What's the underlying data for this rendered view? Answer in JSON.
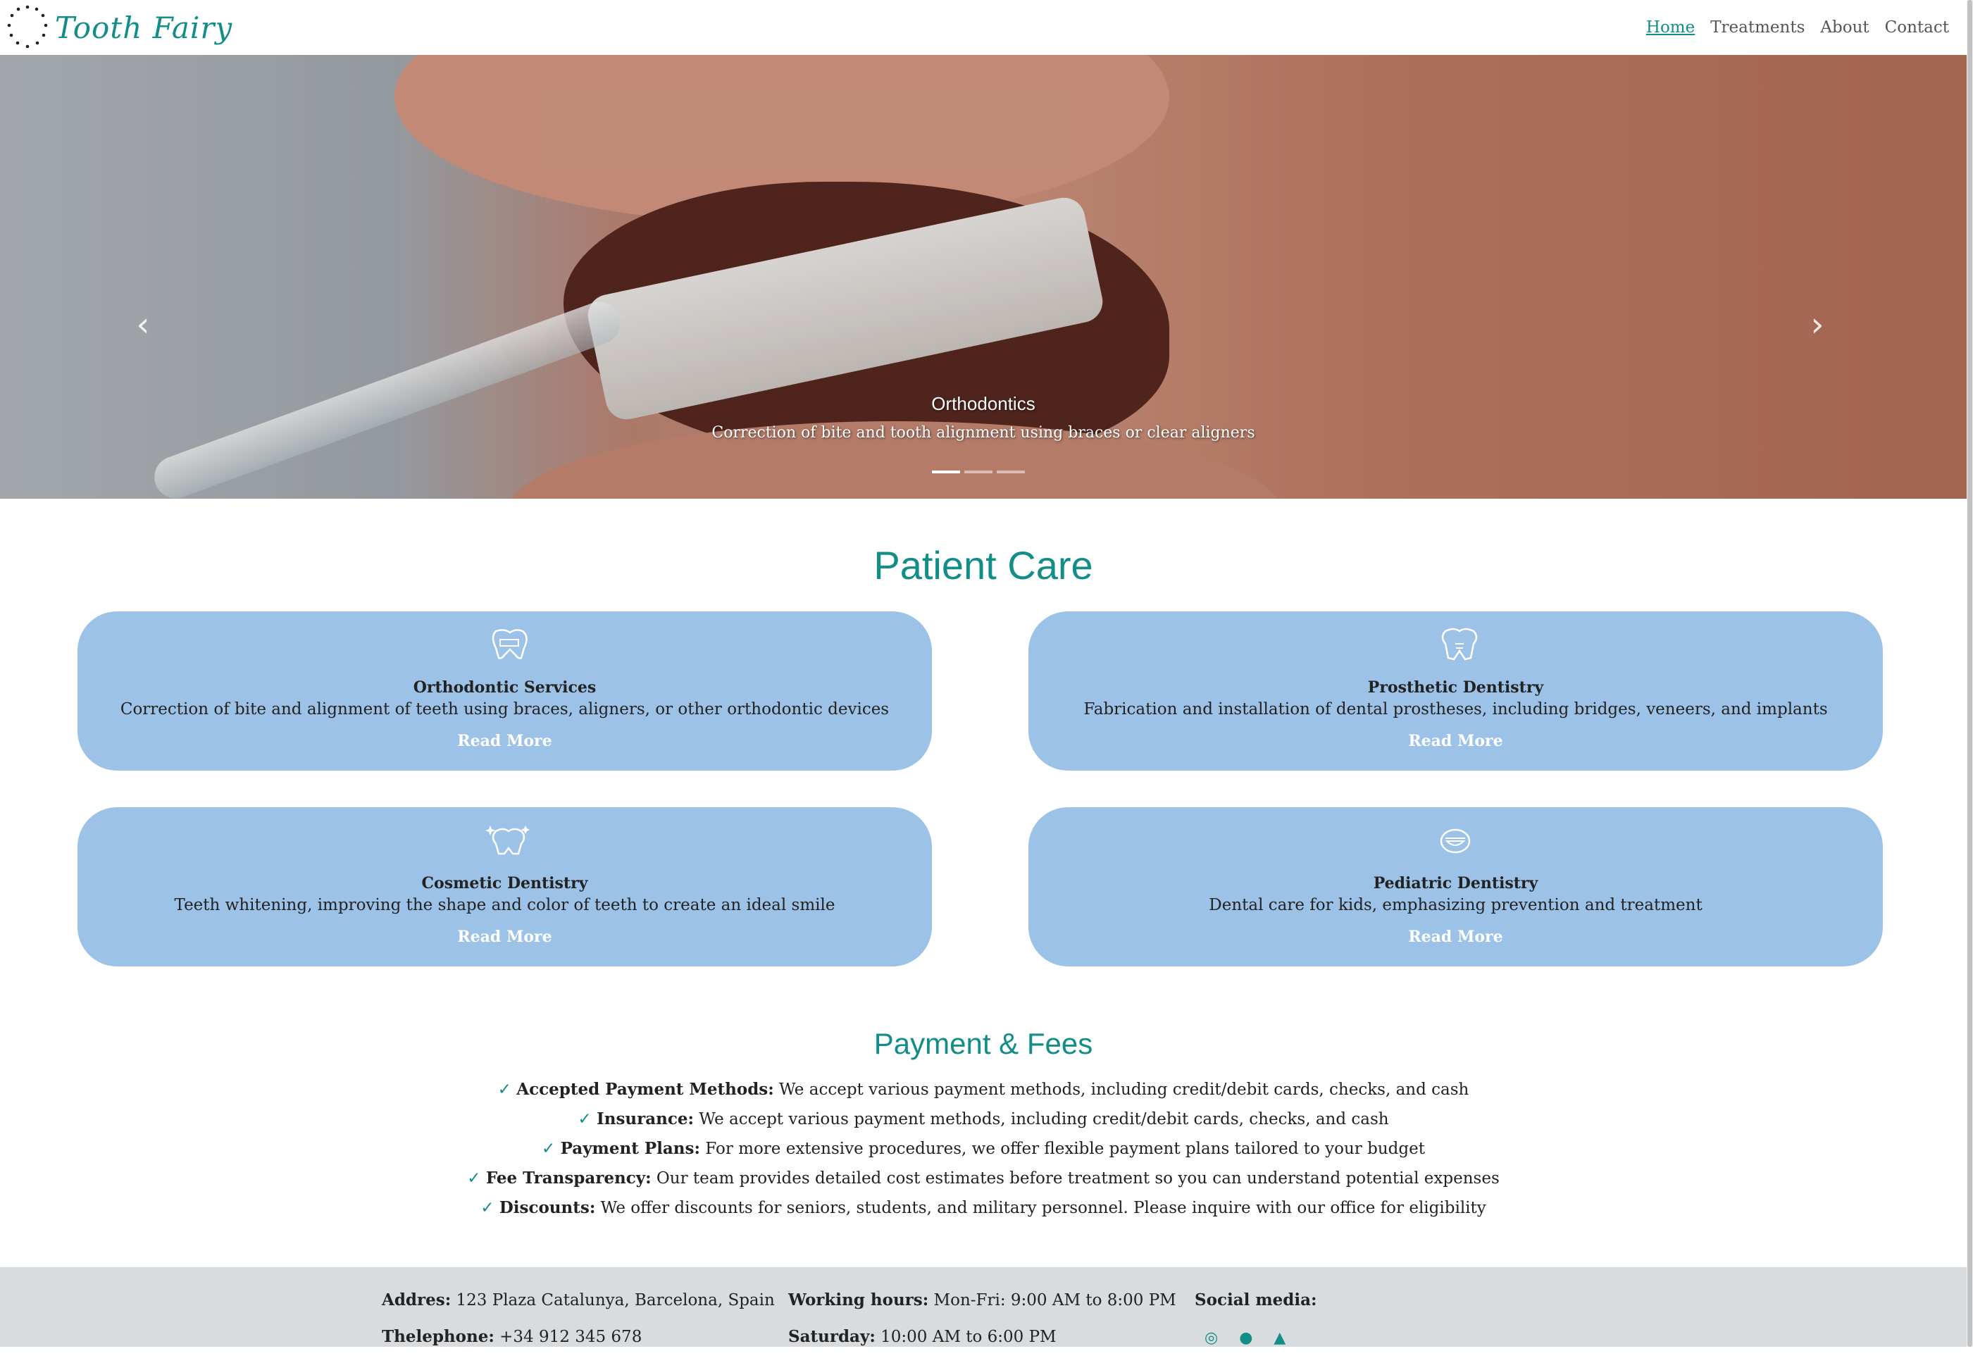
{
  "brand": {
    "name": "Tooth Fairy"
  },
  "nav": [
    {
      "label": "Home",
      "active": true
    },
    {
      "label": "Treatments"
    },
    {
      "label": "About"
    },
    {
      "label": "Contact"
    }
  ],
  "hero": {
    "title": "Orthodontics",
    "subtitle": "Correction of bite and tooth alignment using braces or clear aligners",
    "active_slide": 1,
    "slide_count": 3
  },
  "patient_care": {
    "title": "Patient Care",
    "cards": [
      {
        "icon": "braces-tooth-icon",
        "title": "Orthodontic Services",
        "desc": "Correction of bite and alignment of teeth using braces, aligners, or other orthodontic devices",
        "button": "Read More"
      },
      {
        "icon": "implant-tooth-icon",
        "title": "Prosthetic Dentistry",
        "desc": "Fabrication and installation of dental prostheses, including bridges, veneers, and implants",
        "button": "Read More"
      },
      {
        "icon": "sparkle-tooth-icon",
        "title": "Cosmetic Dentistry",
        "desc": "Teeth whitening, improving the shape and color of teeth to create an ideal smile",
        "button": "Read More"
      },
      {
        "icon": "smile-mouth-icon",
        "title": "Pediatric Dentistry",
        "desc": "Dental care for kids, emphasizing prevention and treatment",
        "button": "Read More"
      }
    ]
  },
  "payment": {
    "title": "Payment & Fees",
    "check": "✓",
    "items": [
      {
        "label": "Accepted Payment Methods:",
        "text": " We accept various payment methods, including credit/debit cards, checks, and cash"
      },
      {
        "label": "Insurance:",
        "text": " We accept various payment methods, including credit/debit cards, checks, and cash"
      },
      {
        "label": "Payment Plans:",
        "text": " For more extensive procedures, we offer flexible payment plans tailored to your budget"
      },
      {
        "label": "Fee Transparency:",
        "text": " Our team provides detailed cost estimates before treatment so you can understand potential expenses"
      },
      {
        "label": "Discounts:",
        "text": " We offer discounts for seniors, students, and military personnel. Please inquire with our office for eligibility"
      }
    ]
  },
  "footer": {
    "address_label": "Addres:",
    "address": " 123 Plaza Catalunya, Barcelona, Spain",
    "phone_label": "Thelephone:",
    "phone": " +34 912 345 678",
    "hours_label": "Working hours:",
    "hours": " Mon-Fri: 9:00 AM to 8:00 PM",
    "saturday_label": "Saturday:",
    "saturday": " 10:00 AM to 6:00 PM",
    "social_label": "Social media:",
    "social_icons": [
      "instagram-icon",
      "facebook-icon",
      "twitter-icon"
    ]
  },
  "colors": {
    "accent": "#128d87",
    "card": "#9cc2e8",
    "footer": "#d8dcdf"
  }
}
